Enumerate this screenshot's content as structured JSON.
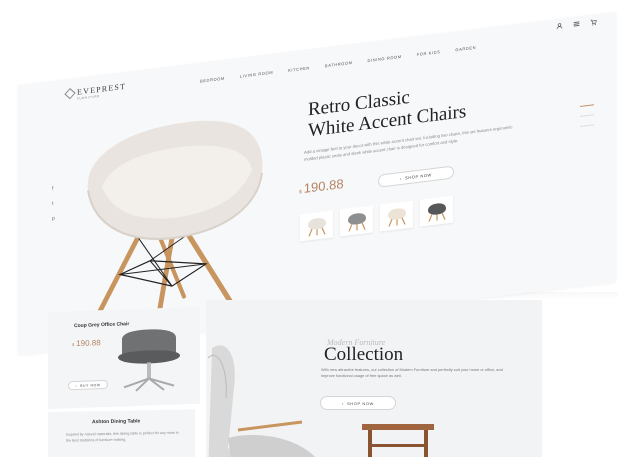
{
  "brand": {
    "name": "EVEPREST",
    "tagline": "FURNITURE"
  },
  "nav": [
    "BEDROOM",
    "LIVING ROOM",
    "KITCHEN",
    "BATHROOM",
    "DINING ROOM",
    "FOR KIDS",
    "GARDEN"
  ],
  "header_icons": [
    "user-icon",
    "menu-icon",
    "cart-icon"
  ],
  "social": [
    "f",
    "t",
    "p"
  ],
  "hero": {
    "title_line1": "Retro Classic",
    "title_line2": "White Accent Chairs",
    "description": "Add a vintage feel to your decor with this white accent chair set. Including two chairs, this set features ergonomic molded plastic seats and sleek white accent chair is designed for comfort and style.",
    "currency": "$",
    "price": "190.88",
    "shop_label": "SHOP NOW",
    "thumbnails": [
      "white-chair",
      "grey-chair",
      "cream-chair",
      "dark-chair"
    ]
  },
  "card_chair": {
    "name": "Coup Grey Office Chair",
    "currency": "$",
    "price": "190.88",
    "buy_label": "BUY NOW"
  },
  "card_table": {
    "name": "Ashton Dining Table",
    "description": "Inspired by natural materials, this dining table is perfect for any room in the best traditions of furniture making."
  },
  "collection": {
    "subtitle": "Modern Furniture",
    "title": "Collection",
    "description": "With new attractive features, our collection of Modern Furniture and perfectly suit your home or office, and improve functional usage of free space as well.",
    "shop_label": "SHOP NOW"
  },
  "colors": {
    "accent": "#b58463",
    "panel": "#f7f8fa",
    "text": "#222222"
  }
}
